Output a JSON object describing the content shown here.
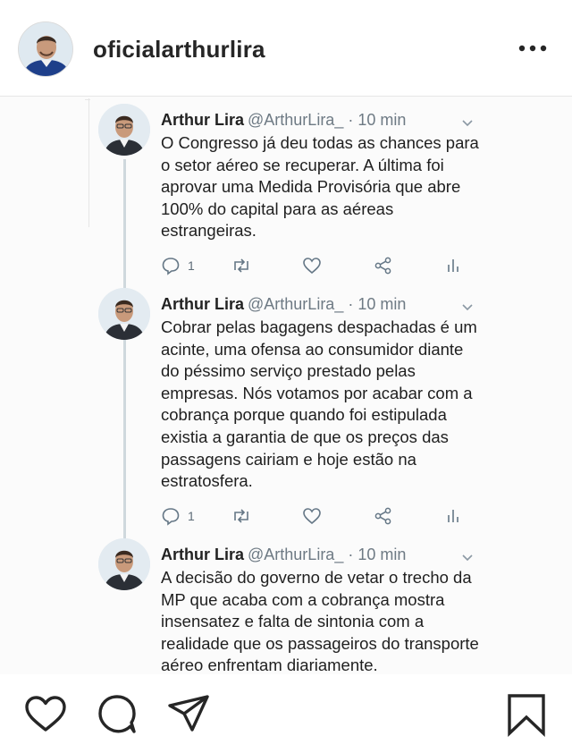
{
  "header": {
    "username": "oficialarthurlira"
  },
  "tweets": [
    {
      "name": "Arthur Lira",
      "meta": "@ArthurLira_ · 10 min",
      "text": "O Congresso já deu todas as chances para o setor aéreo se recuperar. A última foi aprovar uma Medida Provisória que abre 100% do capital para as aéreas estrangeiras.",
      "reply_count": "1"
    },
    {
      "name": "Arthur Lira",
      "meta": "@ArthurLira_ · 10 min",
      "text": "Cobrar pelas bagagens despachadas é um acinte, uma ofensa ao consumidor diante do péssimo serviço prestado pelas empresas. Nós votamos por acabar com a cobrança porque quando foi estipulada existia a garantia de que os preços das passagens cairiam e hoje estão na estratosfera.",
      "reply_count": "1"
    },
    {
      "name": "Arthur Lira",
      "meta": "@ArthurLira_ · 10 min",
      "text": "A decisão do governo de vetar o trecho da MP que acaba com a cobrança mostra insensatez e falta de sintonia com a realidade que os passageiros do transporte aéreo enfrentam diariamente."
    }
  ],
  "icons": {
    "more": "more-options-icon",
    "like": "heart-icon",
    "comment": "comment-icon",
    "share": "paper-plane-icon",
    "save": "bookmark-icon"
  }
}
